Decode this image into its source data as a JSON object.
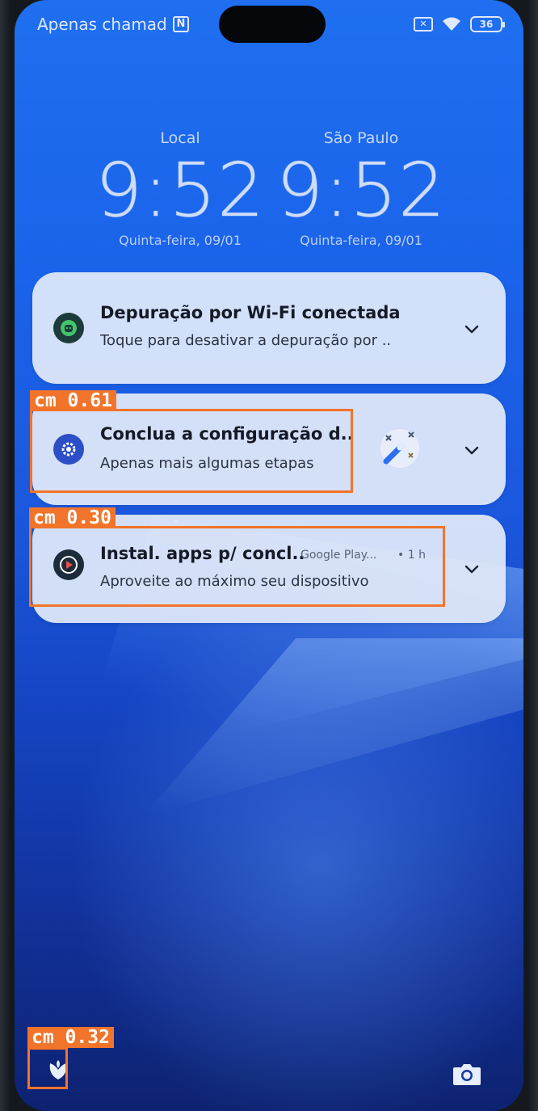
{
  "status_bar": {
    "carrier": "Apenas chamad",
    "battery": "36"
  },
  "clocks": [
    {
      "city": "Local",
      "time": "9:52",
      "date": "Quinta-feira, 09/01"
    },
    {
      "city": "São Paulo",
      "time": "9:52",
      "date": "Quinta-feira, 09/01"
    }
  ],
  "notifications": [
    {
      "title": "Depuração por Wi-Fi conectada",
      "text": "Toque para desativar a depuração por ..",
      "icon": "android-debug-icon"
    },
    {
      "title": "Conclua a configuração d..",
      "text": "Apenas mais algumas etapas",
      "icon": "settings-gear-icon"
    },
    {
      "title": "Instal. apps p/ concl..",
      "source": "Google Play...",
      "time": "• 1 h",
      "text": "Aproveite ao máximo seu dispositivo",
      "icon": "google-play-icon"
    }
  ],
  "detections": [
    {
      "label": "cm 0.61"
    },
    {
      "label": "cm 0.30"
    },
    {
      "label": "cm 0.32"
    }
  ],
  "colors": {
    "detection": "#f2742a",
    "card": "#e2eafa",
    "wallpaper": "#1b59df"
  }
}
